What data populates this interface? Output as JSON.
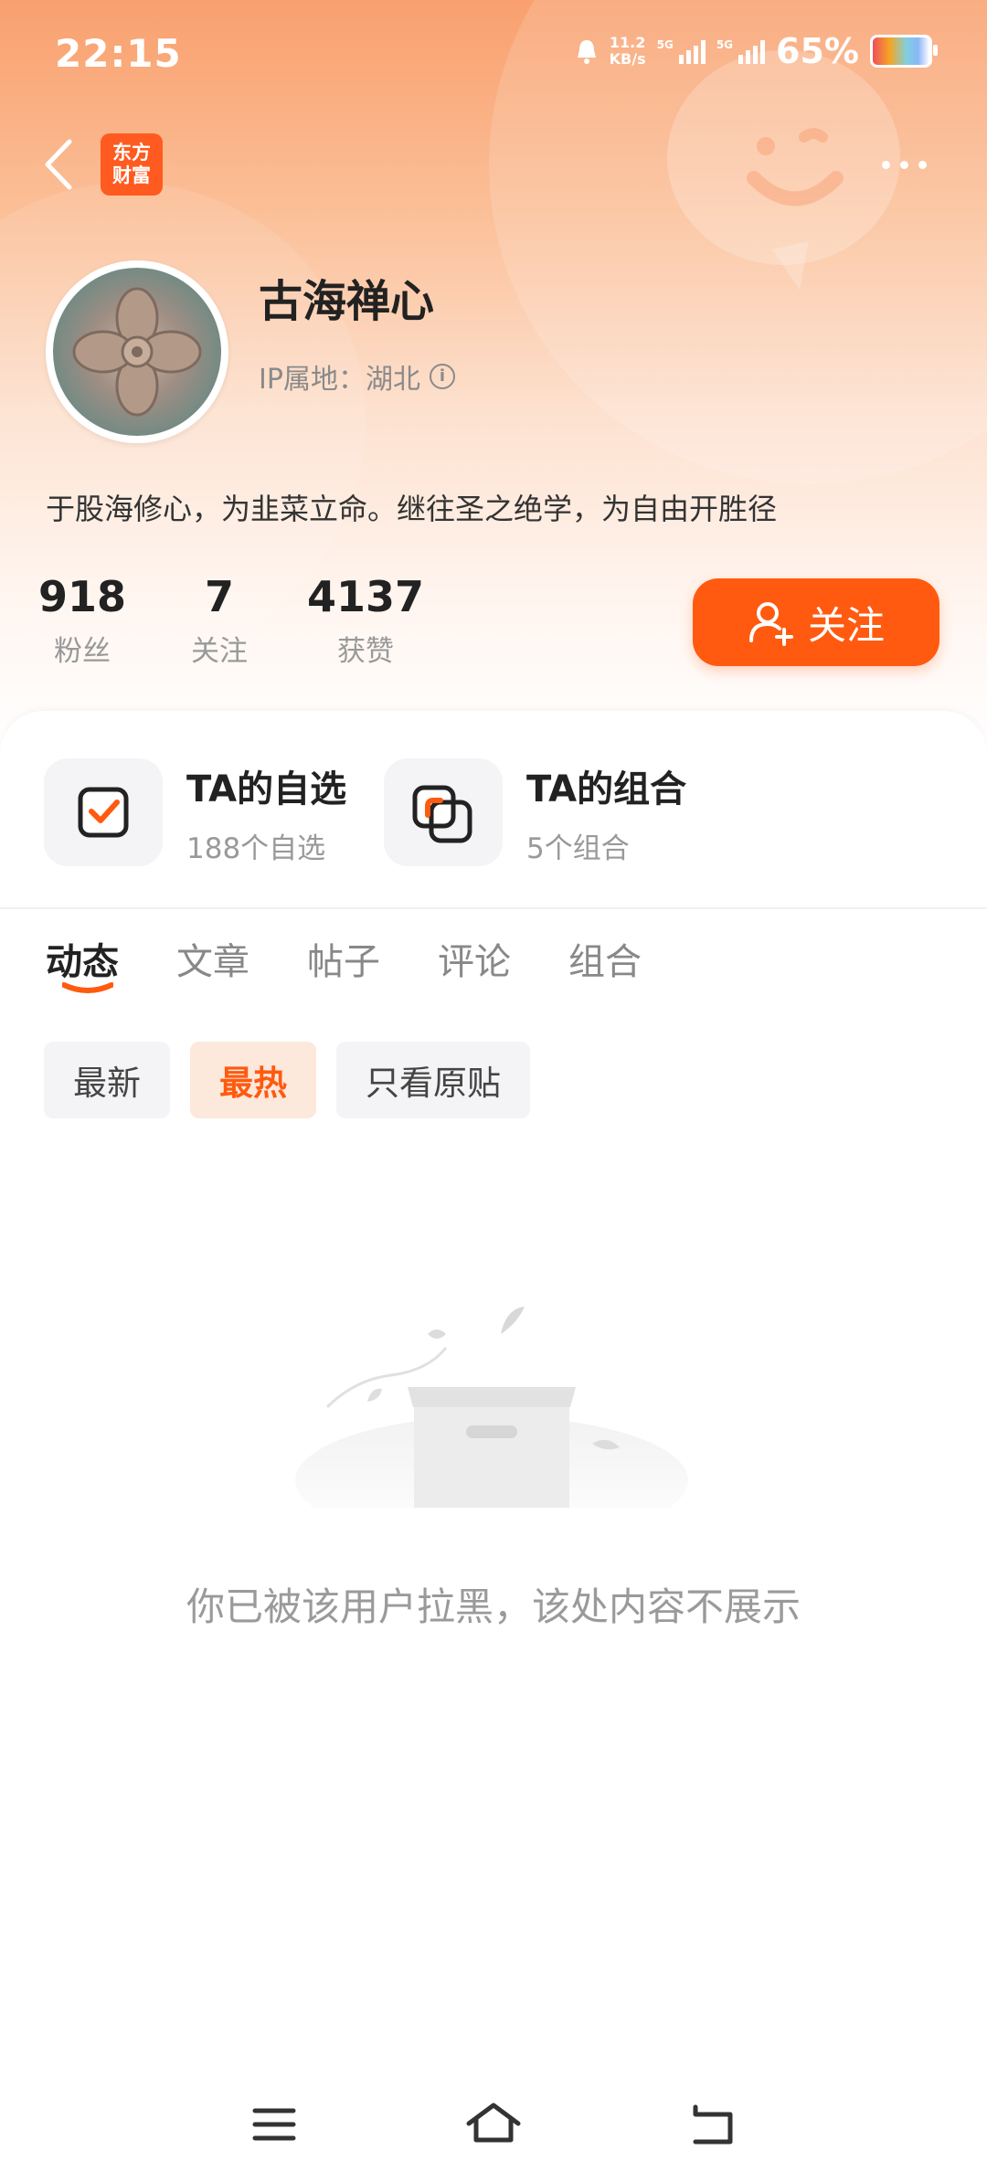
{
  "status_bar": {
    "time": "22:15",
    "net_speed_value": "11.2",
    "net_speed_unit": "KB/s",
    "signal1_label": "5G",
    "signal2_label": "5G",
    "battery_pct": "65%"
  },
  "header": {
    "logo_line1": "东方",
    "logo_line2": "财富"
  },
  "profile": {
    "name": "古海禅心",
    "ip_location": "IP属地：湖北",
    "bio": "于股海修心，为韭菜立命。继往圣之绝学，为自由开胜径"
  },
  "stats": [
    {
      "value": "918",
      "label": "粉丝"
    },
    {
      "value": "7",
      "label": "关注"
    },
    {
      "value": "4137",
      "label": "获赞"
    }
  ],
  "follow_button": {
    "label": "关注"
  },
  "quick_links": [
    {
      "title": "TA的自选",
      "subtitle": "188个自选",
      "icon": "watchlist-icon"
    },
    {
      "title": "TA的组合",
      "subtitle": "5个组合",
      "icon": "portfolio-icon"
    }
  ],
  "tabs": [
    "动态",
    "文章",
    "帖子",
    "评论",
    "组合"
  ],
  "active_tab": "动态",
  "filters": [
    "最新",
    "最热",
    "只看原贴"
  ],
  "active_filter": "最热",
  "empty_state": {
    "message": "你已被该用户拉黑，该处内容不展示",
    "icon": "empty-box-icon"
  },
  "colors": {
    "accent": "#ff5a0f",
    "hero_top": "#f9a06e",
    "text_primary": "#222222",
    "text_secondary": "#999999"
  }
}
